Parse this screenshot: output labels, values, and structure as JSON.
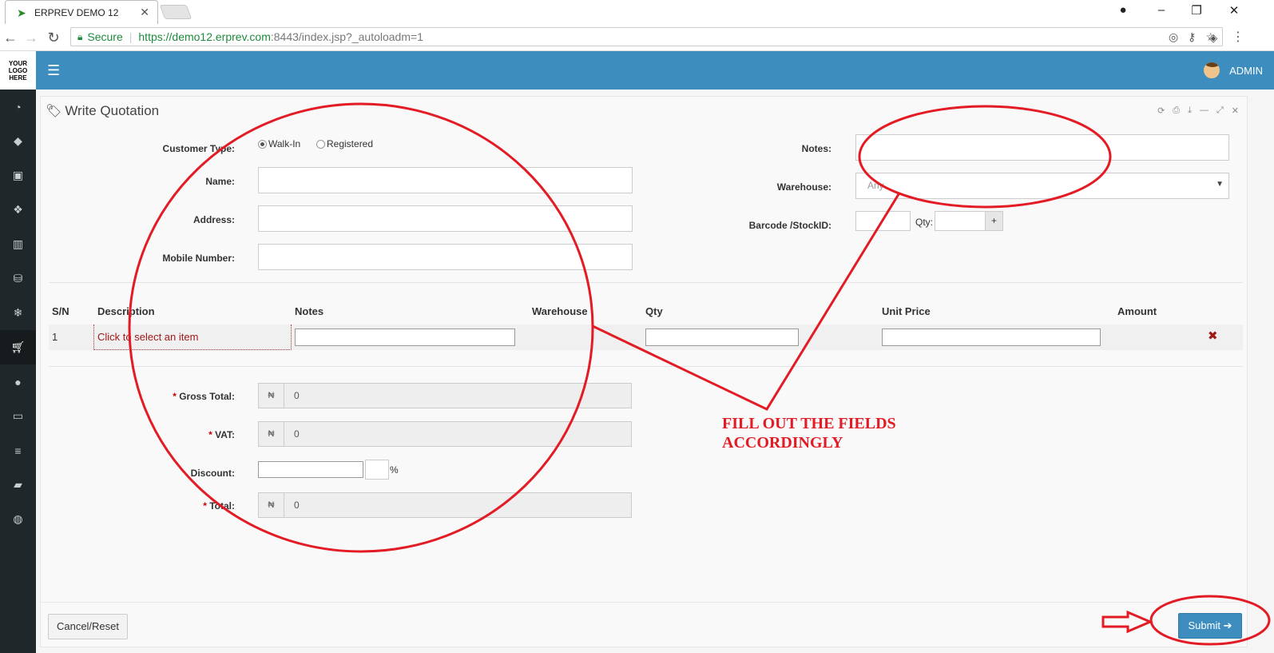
{
  "browser": {
    "tab_title": "ERPREV DEMO 12",
    "secure_label": "Secure",
    "url_host": "https://demo12.erprev.com",
    "url_rest": ":8443/index.jsp?_autoloadm=1"
  },
  "app": {
    "logo_text": "YOUR LOGO HERE",
    "user_name": "ADMIN",
    "accent_color": "#3d8ebf",
    "sidebar_icons": [
      "dashboard-icon",
      "tag-icon",
      "money-icon",
      "cubes-icon",
      "building-icon",
      "database-icon",
      "snowflake-icon",
      "cart-icon",
      "circle-icon",
      "monitor-icon",
      "stack-icon",
      "book-icon",
      "lifebuoy-icon"
    ]
  },
  "panel": {
    "title": "Write Quotation"
  },
  "form": {
    "customer_type_label": "Customer Type:",
    "radio_walkin": "Walk-In",
    "radio_registered": "Registered",
    "name_label": "Name:",
    "address_label": "Address:",
    "mobile_label": "Mobile Number:",
    "notes_label": "Notes:",
    "warehouse_label": "Warehouse:",
    "warehouse_value": "Any",
    "barcode_label": "Barcode /StockID:",
    "qty_label": "Qty:",
    "plus_label": "+"
  },
  "table": {
    "headers": [
      "S/N",
      "Description",
      "Notes",
      "Warehouse",
      "Qty",
      "Unit Price",
      "Amount"
    ],
    "row": {
      "sn": "1",
      "description": "Click to select an item",
      "remove": "✖"
    }
  },
  "totals": {
    "currency": "₦",
    "gross_label": "Gross Total:",
    "gross_value": "0",
    "vat_label": "VAT:",
    "vat_value": "0",
    "discount_label": "Discount:",
    "percent": "%",
    "total_label": "Total:",
    "total_value": "0",
    "required_mark": "*"
  },
  "buttons": {
    "cancel_reset": "Cancel/Reset",
    "submit": "Submit"
  },
  "annotation": {
    "line1": "FILL OUT THE FIELDS",
    "line2": "ACCORDINGLY",
    "color": "#e21b24"
  }
}
